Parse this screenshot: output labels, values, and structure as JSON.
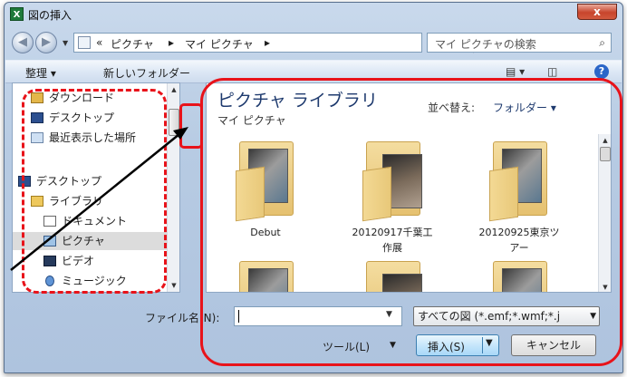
{
  "window": {
    "title": "図の挿入",
    "close_label": "x"
  },
  "address": {
    "crumb_prefix": "«",
    "crumbs": [
      "ピクチャ",
      "マイ ピクチャ"
    ],
    "separator": "▸"
  },
  "search": {
    "placeholder": "マイ ピクチャの検索"
  },
  "toolbar": {
    "organize": "整理 ▾",
    "new_folder": "新しいフォルダー"
  },
  "nav": {
    "items": [
      {
        "label": "ダウンロード",
        "icon": "download-folder-icon"
      },
      {
        "label": "デスクトップ",
        "icon": "desktop-icon"
      },
      {
        "label": "最近表示した場所",
        "icon": "recent-places-icon"
      },
      {
        "label": "デスクトップ",
        "icon": "desktop-icon"
      },
      {
        "label": "ライブラリ",
        "icon": "library-icon"
      },
      {
        "label": "ドキュメント",
        "icon": "document-icon"
      },
      {
        "label": "ピクチャ",
        "icon": "picture-icon",
        "selected": true
      },
      {
        "label": "ビデオ",
        "icon": "video-icon"
      },
      {
        "label": "ミュージック",
        "icon": "music-icon"
      }
    ]
  },
  "content": {
    "library_title": "ピクチャ ライブラリ",
    "library_subtitle": "マイ ピクチャ",
    "sort_label": "並べ替え:",
    "sort_value": "フォルダー ▾",
    "folders": [
      {
        "name": "Debut"
      },
      {
        "name": "20120917千葉工\n作展"
      },
      {
        "name": "20120925東京ツ\nアー"
      },
      {
        "name": ""
      },
      {
        "name": ""
      },
      {
        "name": ""
      }
    ]
  },
  "footer": {
    "filename_label": "ファイル名(N):",
    "filename_value": "",
    "filetype_value": "すべての図 (*.emf;*.wmf;*.j",
    "tools_label": "ツール(L)",
    "insert_label": "挿入(S)",
    "cancel_label": "キャンセル"
  },
  "colors": {
    "annotation": "#e8131a",
    "selection": "#dcdcdc"
  }
}
